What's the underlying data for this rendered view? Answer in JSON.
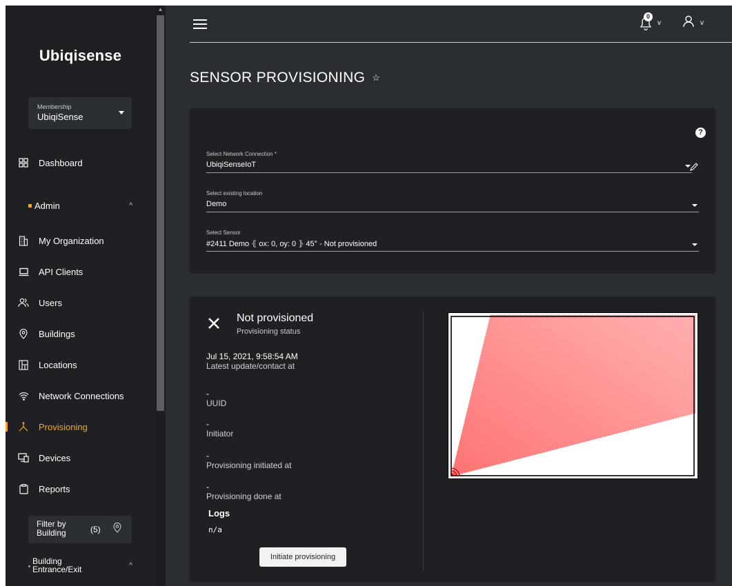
{
  "app": {
    "brand": "Ubiqisense"
  },
  "membership": {
    "label": "Membership",
    "value": "UbiqiSense"
  },
  "sidebar": {
    "dashboard": "Dashboard",
    "admin_section": "Admin",
    "items": [
      {
        "label": "My Organization",
        "icon": "building-icon"
      },
      {
        "label": "API Clients",
        "icon": "laptop-icon"
      },
      {
        "label": "Users",
        "icon": "users-icon"
      },
      {
        "label": "Buildings",
        "icon": "pin-icon"
      },
      {
        "label": "Locations",
        "icon": "floorplan-icon"
      },
      {
        "label": "Network Connections",
        "icon": "wifi-icon"
      },
      {
        "label": "Provisioning",
        "icon": "provisioning-icon",
        "active": true
      },
      {
        "label": "Devices",
        "icon": "devices-icon"
      },
      {
        "label": "Reports",
        "icon": "clipboard-icon"
      }
    ],
    "filter": {
      "label_line1": "Filter by",
      "label_line2": "Building",
      "count": "(5)"
    },
    "section2": {
      "line1": "Building",
      "line2": "Entrance/Exit"
    }
  },
  "header": {
    "notification_count": "0"
  },
  "page": {
    "title": "SENSOR PROVISIONING"
  },
  "form": {
    "network": {
      "label": "Select Network Connection *",
      "value": "UbiqiSenseIoT"
    },
    "location": {
      "label": "Select existing location",
      "value": "Demo"
    },
    "sensor": {
      "label": "Select Sensor",
      "value": "#2411 Demo ⦃ ox: 0, oy: 0 ⦄ 45° - Not provisioned"
    }
  },
  "status": {
    "title": "Not provisioned",
    "subtitle": "Provisioning status",
    "latest_value": "Jul 15, 2021, 9:58:54 AM",
    "latest_label": "Latest update/contact at",
    "uuid_value": "-",
    "uuid_label": "UUID",
    "initiator_value": "-",
    "initiator_label": "Initiator",
    "initiated_value": "-",
    "initiated_label": "Provisioning initiated at",
    "done_value": "-",
    "done_label": "Provisioning done at",
    "logs_heading": "Logs",
    "logs_value": "n/a",
    "button": "Initiate provisioning"
  },
  "colors": {
    "accent": "#f5a623",
    "sensor_cone": "#ff6b6b",
    "background": "#2a2d31",
    "panel": "#1e2023"
  }
}
